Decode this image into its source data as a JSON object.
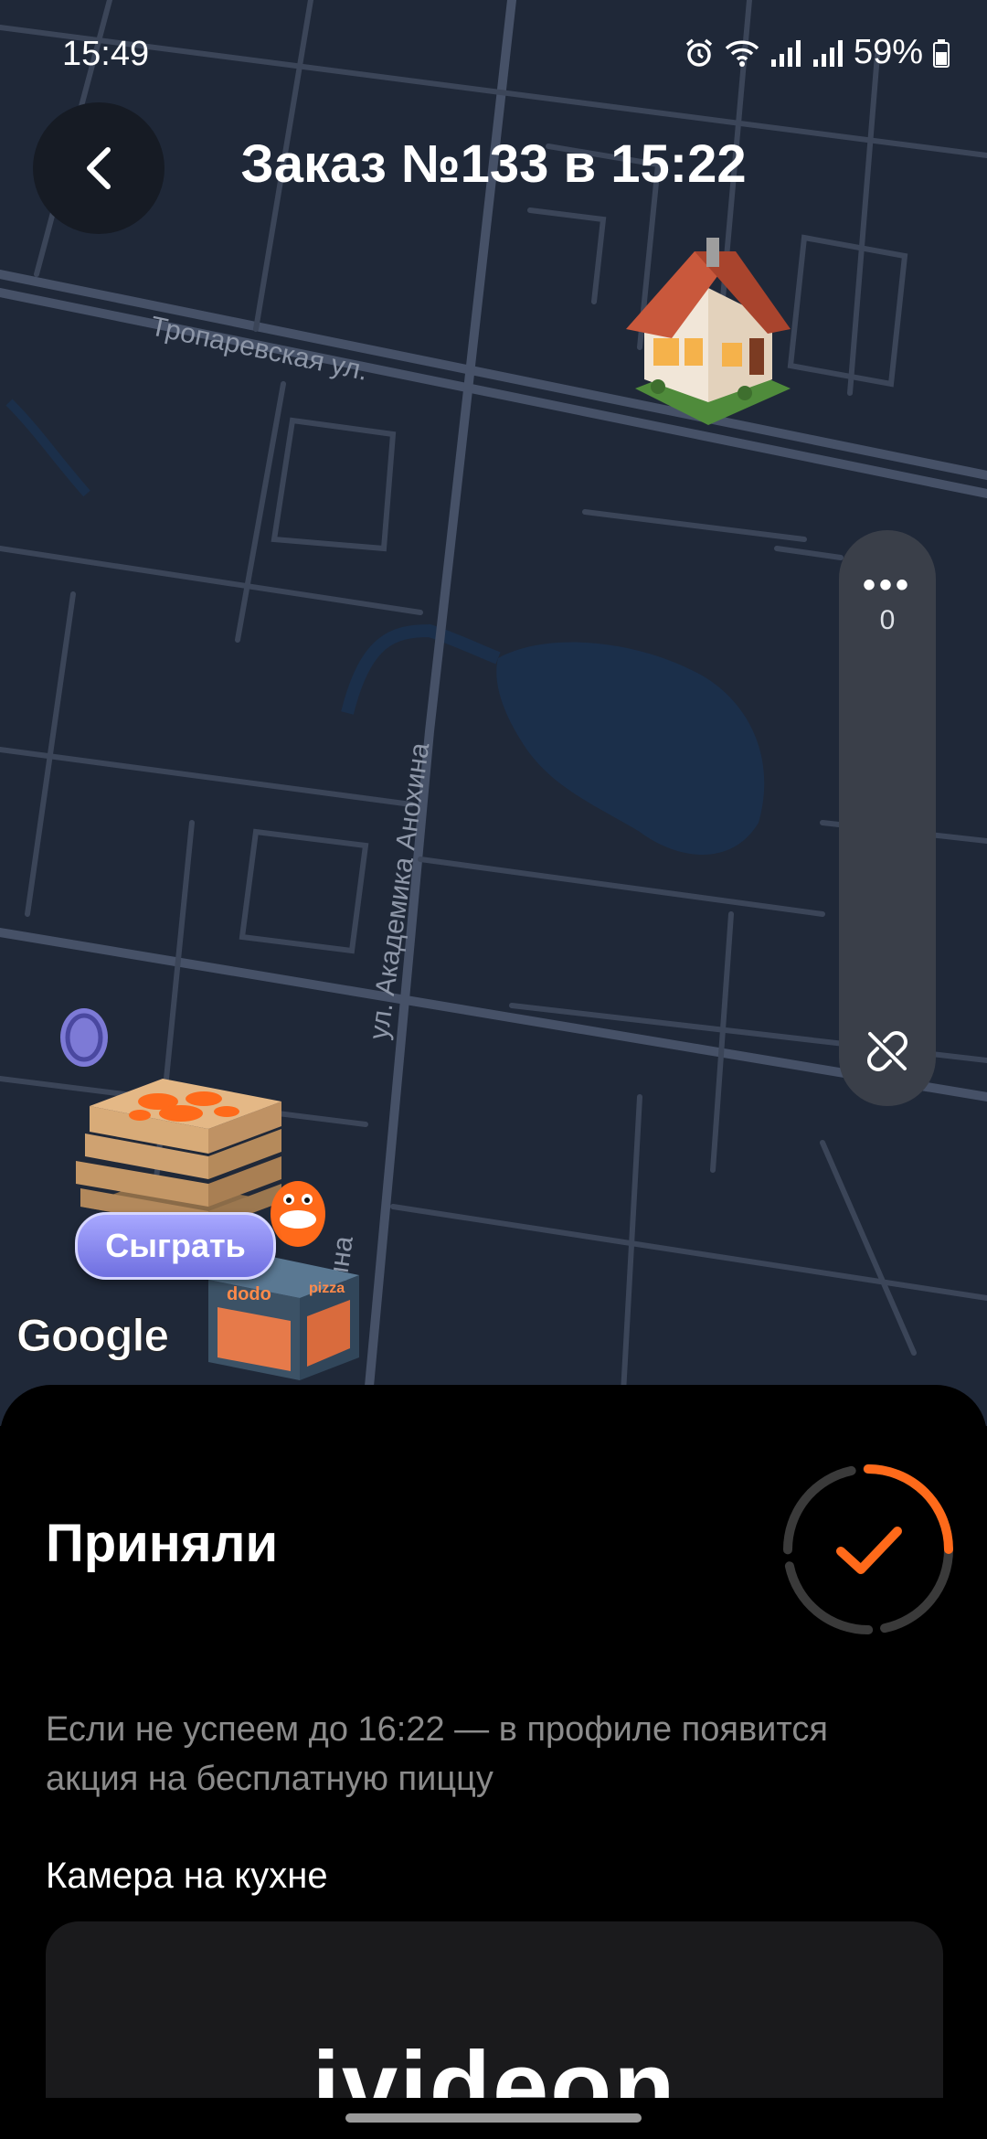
{
  "status_bar": {
    "time": "15:49",
    "battery": "59%"
  },
  "header": {
    "title": "Заказ №133 в 15:22"
  },
  "map": {
    "streets": [
      "Тропаревская ул.",
      "ул. Академика Анохина",
      "хина"
    ],
    "attribution": "Google",
    "couriers_count": "0",
    "game_button_label": "Сыграть"
  },
  "order": {
    "status": "Приняли",
    "promise_text": "Если не успеем до 16:22 — в профиле появится акция на бесплатную пиццу",
    "camera_title": "Камера на кухне",
    "camera_brand": "ivideon"
  },
  "colors": {
    "accent": "#ff6a1a",
    "map_bg": "#1f2838",
    "road": "#3f4a5e",
    "sheet_bg": "#000000",
    "muted_text": "#8b8b8b"
  },
  "icons": {
    "back": "chevron-left-icon",
    "more": "more-dots-icon",
    "no_link": "link-off-icon",
    "check": "checkmark-icon"
  }
}
